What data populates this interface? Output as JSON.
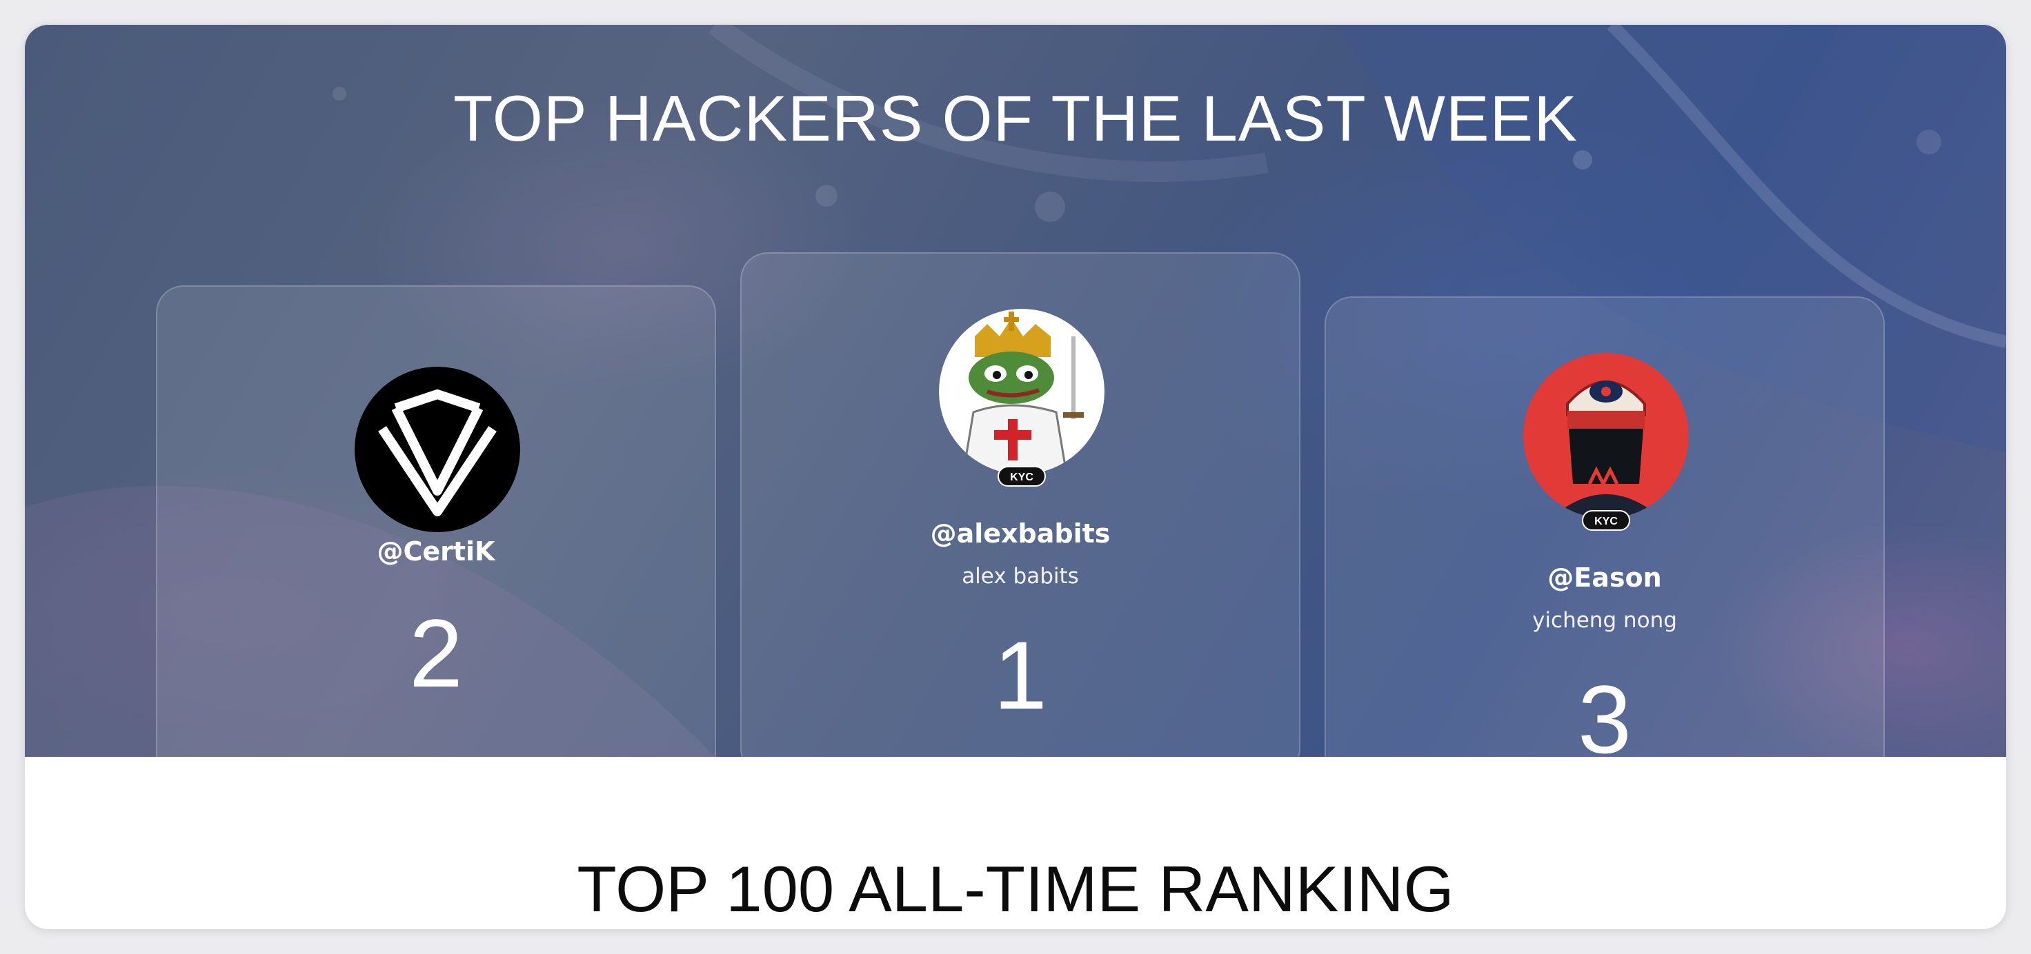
{
  "hero": {
    "title": "TOP HACKERS OF THE LAST WEEK"
  },
  "podium": [
    {
      "rank": "2",
      "handle": "@CertiK",
      "name": "",
      "kyc": "",
      "avatar_icon": "certik-logo-icon"
    },
    {
      "rank": "1",
      "handle": "@alexbabits",
      "name": "alex babits",
      "kyc": "KYC",
      "avatar_icon": "crowned-frog-knight-avatar"
    },
    {
      "rank": "3",
      "handle": "@Eason",
      "name": "yicheng nong",
      "kyc": "KYC",
      "avatar_icon": "cap-hacker-avatar"
    }
  ],
  "ranking": {
    "title": "TOP 100 ALL-TIME RANKING"
  },
  "colors": {
    "hero_base": "#4a5a7a",
    "text_light": "#ffffff",
    "text_dark": "#0c0c0c",
    "kyc_badge": "#111111",
    "eason_avatar_bg": "#e23a36"
  }
}
